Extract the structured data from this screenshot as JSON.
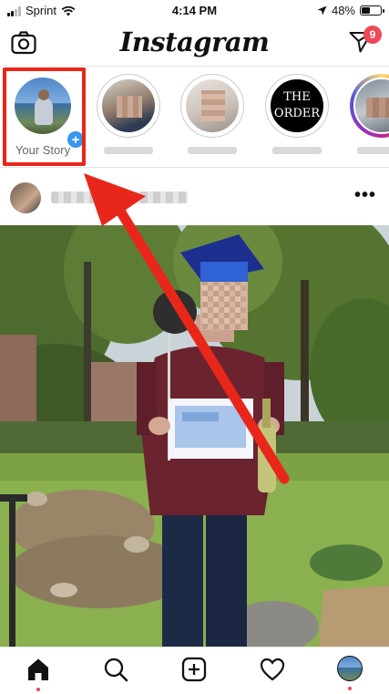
{
  "status_bar": {
    "carrier": "Sprint",
    "time": "4:14 PM",
    "battery": "48%",
    "battery_level": 0.48
  },
  "header": {
    "logo": "Instagram",
    "camera_icon": "camera-icon",
    "direct_icon": "paper-plane-icon",
    "direct_badge": "9"
  },
  "stories": {
    "your_story_label": "Your Story",
    "items": [
      {
        "type": "your-story"
      },
      {
        "type": "seen"
      },
      {
        "type": "seen"
      },
      {
        "type": "seen",
        "avatar_text": "THE ORDER"
      },
      {
        "type": "new"
      }
    ]
  },
  "post": {
    "more_icon": "more-dots-icon",
    "sign_text": ""
  },
  "bottom_nav": {
    "items": [
      "home-icon",
      "search-icon",
      "add-post-icon",
      "heart-icon",
      "profile-avatar"
    ]
  },
  "colors": {
    "highlight": "#e8271a",
    "badge": "#ed4956",
    "plus": "#3897f0"
  }
}
